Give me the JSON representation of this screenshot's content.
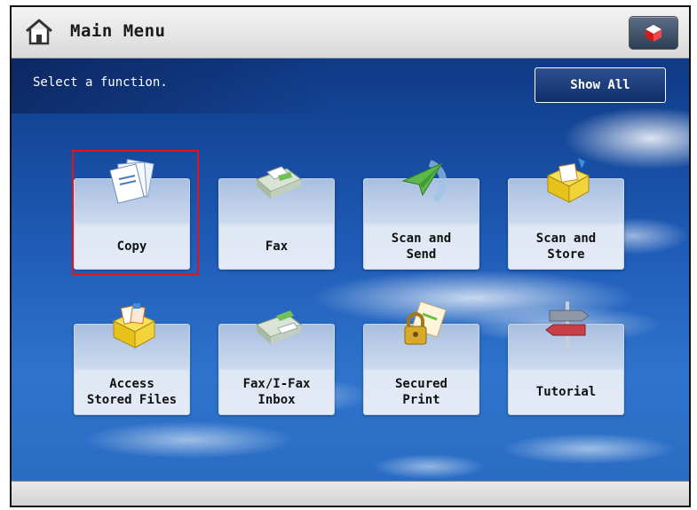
{
  "header": {
    "title": "Main Menu"
  },
  "prompt": {
    "text": "Select a function."
  },
  "buttons": {
    "show_all": "Show All"
  },
  "tiles": [
    {
      "label": "Copy",
      "icon": "copy-icon"
    },
    {
      "label": "Fax",
      "icon": "fax-icon"
    },
    {
      "label": "Scan and\nSend",
      "icon": "scan-send-icon"
    },
    {
      "label": "Scan and\nStore",
      "icon": "scan-store-icon"
    },
    {
      "label": "Access\nStored Files",
      "icon": "stored-files-icon"
    },
    {
      "label": "Fax/I-Fax\nInbox",
      "icon": "fax-inbox-icon"
    },
    {
      "label": "Secured\nPrint",
      "icon": "secured-print-icon"
    },
    {
      "label": "Tutorial",
      "icon": "tutorial-icon"
    }
  ],
  "selected_tile": "Copy",
  "colors": {
    "selection": "#e0141a",
    "sky": "#1f5cb8"
  }
}
